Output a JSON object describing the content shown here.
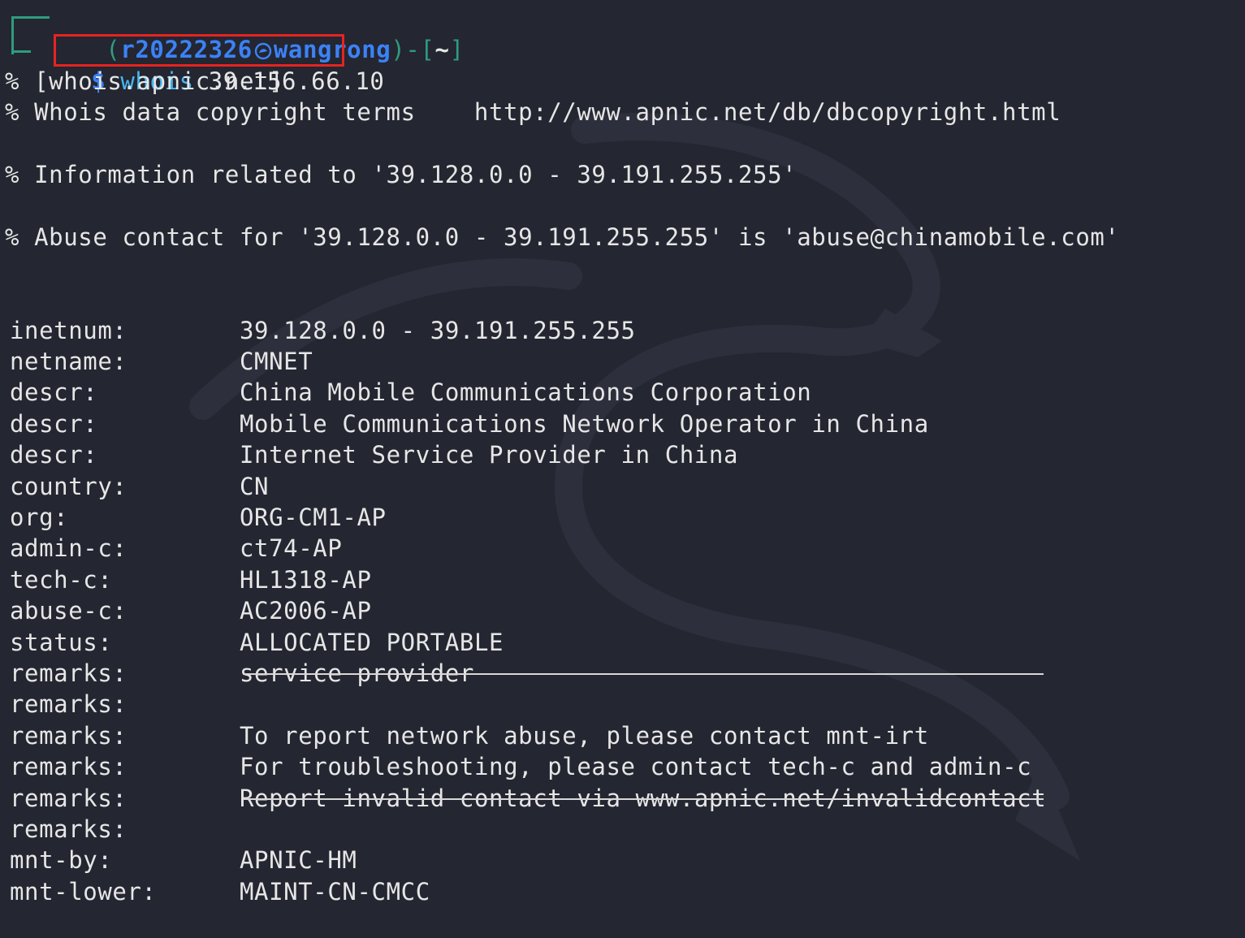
{
  "prompt": {
    "open": "┌──(",
    "user": "r20222326",
    "host": "wangrong",
    "close_bracket": ")-[",
    "dir": "~",
    "end_bracket": "]",
    "dollar": "$",
    "command": "whois",
    "argument": "39.156.66.10"
  },
  "header_lines": [
    "% [whois.apnic.net]",
    "% Whois data copyright terms    http://www.apnic.net/db/dbcopyright.html",
    "% Information related to '39.128.0.0 - 39.191.255.255'",
    "% Abuse contact for '39.128.0.0 - 39.191.255.255' is 'abuse@chinamobile.com'"
  ],
  "records": [
    {
      "key": "inetnum:",
      "value": "39.128.0.0 - 39.191.255.255"
    },
    {
      "key": "netname:",
      "value": "CMNET"
    },
    {
      "key": "descr:",
      "value": "China Mobile Communications Corporation"
    },
    {
      "key": "descr:",
      "value": "Mobile Communications Network Operator in China"
    },
    {
      "key": "descr:",
      "value": "Internet Service Provider in China"
    },
    {
      "key": "country:",
      "value": "CN"
    },
    {
      "key": "org:",
      "value": "ORG-CM1-AP"
    },
    {
      "key": "admin-c:",
      "value": "ct74-AP"
    },
    {
      "key": "tech-c:",
      "value": "HL1318-AP"
    },
    {
      "key": "abuse-c:",
      "value": "AC2006-AP"
    },
    {
      "key": "status:",
      "value": "ALLOCATED PORTABLE"
    },
    {
      "key": "remarks:",
      "value": "service provider"
    },
    {
      "key": "remarks:",
      "value": ""
    },
    {
      "key": "remarks:",
      "value": "To report network abuse, please contact mnt-irt"
    },
    {
      "key": "remarks:",
      "value": "For troubleshooting, please contact tech-c and admin-c"
    },
    {
      "key": "remarks:",
      "value": "Report invalid contact via www.apnic.net/invalidcontact"
    },
    {
      "key": "remarks:",
      "value": ""
    },
    {
      "key": "mnt-by:",
      "value": "APNIC-HM"
    },
    {
      "key": "mnt-lower:",
      "value": "MAINT-CN-CMCC"
    }
  ],
  "colors": {
    "background": "#242631",
    "prompt_frame": "#2f9c7e",
    "prompt_user": "#3b82f6",
    "command": "#46b6f0",
    "highlight_box": "#e52421",
    "text": "#e6e6e6"
  },
  "icons": {
    "host_separator": "kali-skull-icon"
  }
}
